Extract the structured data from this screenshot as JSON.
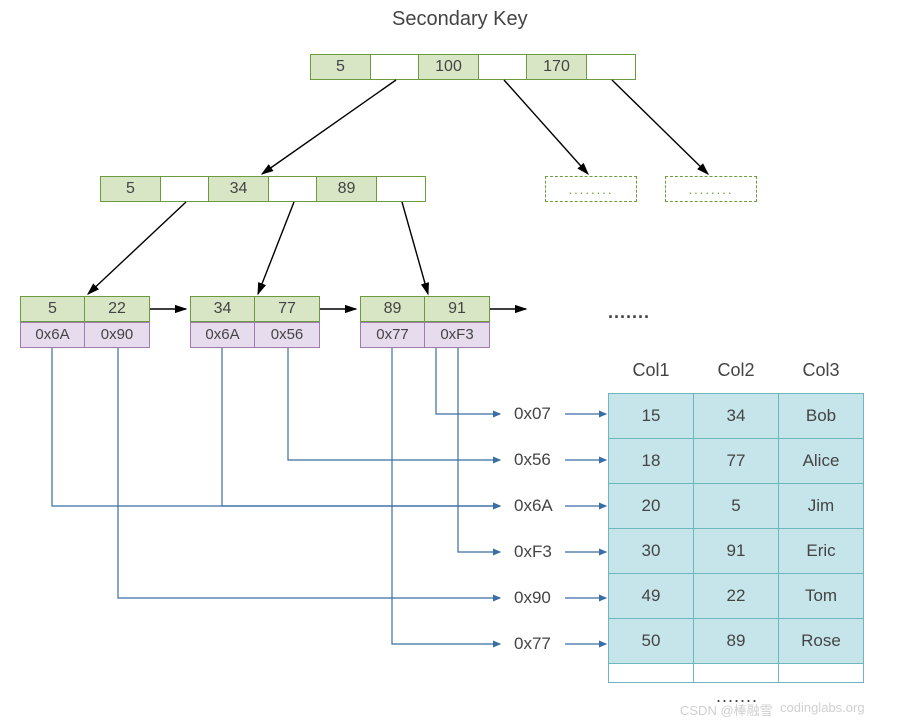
{
  "title": "Secondary Key",
  "root_node": {
    "keys": [
      "5",
      "100",
      "170"
    ]
  },
  "mid_node": {
    "keys": [
      "5",
      "34",
      "89"
    ]
  },
  "mid_placeholders": [
    "........",
    "........"
  ],
  "leaves": [
    {
      "keys": [
        "5",
        "22"
      ],
      "refs": [
        "0x6A",
        "0x90"
      ]
    },
    {
      "keys": [
        "34",
        "77"
      ],
      "refs": [
        "0x6A",
        "0x56"
      ]
    },
    {
      "keys": [
        "89",
        "91"
      ],
      "refs": [
        "0x77",
        "0xF3"
      ]
    }
  ],
  "leaf_overflow": ".......",
  "row_labels": [
    "0x07",
    "0x56",
    "0x6A",
    "0xF3",
    "0x90",
    "0x77"
  ],
  "table": {
    "headers": [
      "Col1",
      "Col2",
      "Col3"
    ],
    "rows": [
      [
        "15",
        "34",
        "Bob"
      ],
      [
        "18",
        "77",
        "Alice"
      ],
      [
        "20",
        "5",
        "Jim"
      ],
      [
        "30",
        "91",
        "Eric"
      ],
      [
        "49",
        "22",
        "Tom"
      ],
      [
        "50",
        "89",
        "Rose"
      ]
    ],
    "footer": "......."
  },
  "watermark_left": "CSDN @棒融雪",
  "watermark_right": "codinglabs.org",
  "chart_data": {
    "type": "diagram",
    "description": "B+ tree secondary index: root node keys [5,100,170]; one internal child shown with keys [5,34,89]; three leaf nodes with (key, primary-key-pointer) pairs; pointers map via 0x-addresses into data table rows",
    "root_keys": [
      5,
      100,
      170
    ],
    "internal_keys": [
      5,
      34,
      89
    ],
    "leaf_entries": [
      {
        "secondary_key": 5,
        "pointer": "0x6A"
      },
      {
        "secondary_key": 22,
        "pointer": "0x90"
      },
      {
        "secondary_key": 34,
        "pointer": "0x6A"
      },
      {
        "secondary_key": 77,
        "pointer": "0x56"
      },
      {
        "secondary_key": 89,
        "pointer": "0x77"
      },
      {
        "secondary_key": 91,
        "pointer": "0xF3"
      }
    ],
    "data_rows": [
      {
        "addr": "0x07",
        "Col1": 15,
        "Col2": 34,
        "Col3": "Bob"
      },
      {
        "addr": "0x56",
        "Col1": 18,
        "Col2": 77,
        "Col3": "Alice"
      },
      {
        "addr": "0x6A",
        "Col1": 20,
        "Col2": 5,
        "Col3": "Jim"
      },
      {
        "addr": "0xF3",
        "Col1": 30,
        "Col2": 91,
        "Col3": "Eric"
      },
      {
        "addr": "0x90",
        "Col1": 49,
        "Col2": 22,
        "Col3": "Tom"
      },
      {
        "addr": "0x77",
        "Col1": 50,
        "Col2": 89,
        "Col3": "Rose"
      }
    ]
  }
}
